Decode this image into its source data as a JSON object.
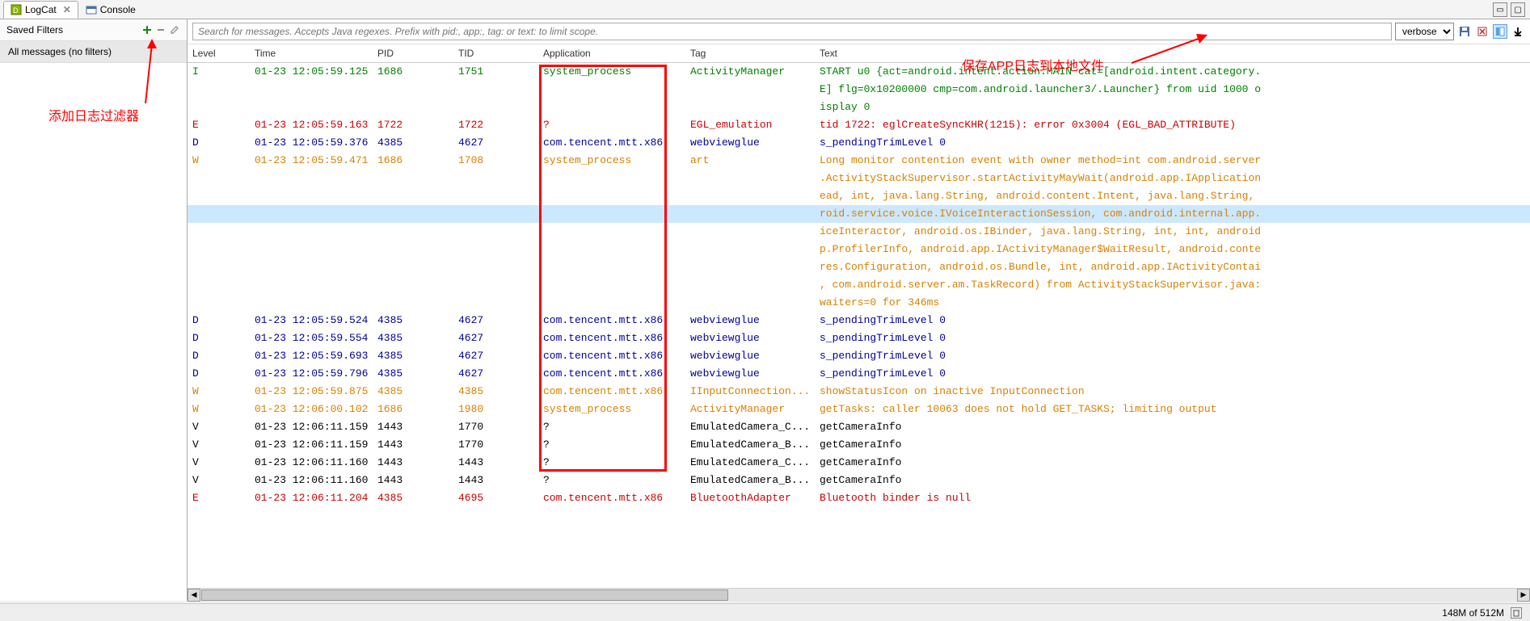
{
  "tabs": [
    {
      "label": "LogCat",
      "active": true
    },
    {
      "label": "Console",
      "active": false
    }
  ],
  "sidebar": {
    "title": "Saved Filters",
    "filter_item": "All messages (no filters)"
  },
  "annotations": {
    "add_filter": "添加日志过滤器",
    "save_log": "保存APP日志到本地文件"
  },
  "search": {
    "placeholder": "Search for messages. Accepts Java regexes. Prefix with pid:, app:, tag: or text: to limit scope."
  },
  "level_filter": {
    "value": "verbose"
  },
  "columns": {
    "level": "Level",
    "time": "Time",
    "pid": "PID",
    "tid": "TID",
    "app": "Application",
    "tag": "Tag",
    "text": "Text"
  },
  "logs": [
    {
      "lvl": "I",
      "time": "01-23 12:05:59.125",
      "pid": "1686",
      "tid": "1751",
      "app": "system_process",
      "tag": "ActivityManager",
      "text": "START u0 {act=android.intent.action.MAIN cat=[android.intent.category."
    },
    {
      "lvl": "",
      "time": "",
      "pid": "",
      "tid": "",
      "app": "",
      "tag": "",
      "text": "E] flg=0x10200000 cmp=com.android.launcher3/.Launcher} from uid 1000 o",
      "cls": "I"
    },
    {
      "lvl": "",
      "time": "",
      "pid": "",
      "tid": "",
      "app": "",
      "tag": "",
      "text": "isplay 0",
      "cls": "I"
    },
    {
      "lvl": "E",
      "time": "01-23 12:05:59.163",
      "pid": "1722",
      "tid": "1722",
      "app": "?",
      "tag": "EGL_emulation",
      "text": "tid 1722: eglCreateSyncKHR(1215): error 0x3004 (EGL_BAD_ATTRIBUTE)"
    },
    {
      "lvl": "D",
      "time": "01-23 12:05:59.376",
      "pid": "4385",
      "tid": "4627",
      "app": "com.tencent.mtt.x86",
      "tag": "webviewglue",
      "text": "s_pendingTrimLevel 0"
    },
    {
      "lvl": "W",
      "time": "01-23 12:05:59.471",
      "pid": "1686",
      "tid": "1708",
      "app": "system_process",
      "tag": "art",
      "text": "Long monitor contention event with owner method=int com.android.server"
    },
    {
      "lvl": "",
      "time": "",
      "pid": "",
      "tid": "",
      "app": "",
      "tag": "",
      "text": ".ActivityStackSupervisor.startActivityMayWait(android.app.IApplication",
      "cls": "W"
    },
    {
      "lvl": "",
      "time": "",
      "pid": "",
      "tid": "",
      "app": "",
      "tag": "",
      "text": "ead, int, java.lang.String, android.content.Intent, java.lang.String,",
      "cls": "W"
    },
    {
      "lvl": "",
      "time": "",
      "pid": "",
      "tid": "",
      "app": "",
      "tag": "",
      "text": "roid.service.voice.IVoiceInteractionSession, com.android.internal.app.",
      "cls": "W",
      "hl": true
    },
    {
      "lvl": "",
      "time": "",
      "pid": "",
      "tid": "",
      "app": "",
      "tag": "",
      "text": "iceInteractor, android.os.IBinder, java.lang.String, int, int, android",
      "cls": "W"
    },
    {
      "lvl": "",
      "time": "",
      "pid": "",
      "tid": "",
      "app": "",
      "tag": "",
      "text": "p.ProfilerInfo, android.app.IActivityManager$WaitResult, android.conte",
      "cls": "W"
    },
    {
      "lvl": "",
      "time": "",
      "pid": "",
      "tid": "",
      "app": "",
      "tag": "",
      "text": "res.Configuration, android.os.Bundle, int, android.app.IActivityContai",
      "cls": "W"
    },
    {
      "lvl": "",
      "time": "",
      "pid": "",
      "tid": "",
      "app": "",
      "tag": "",
      "text": ", com.android.server.am.TaskRecord) from ActivityStackSupervisor.java:",
      "cls": "W"
    },
    {
      "lvl": "",
      "time": "",
      "pid": "",
      "tid": "",
      "app": "",
      "tag": "",
      "text": " waiters=0 for 346ms",
      "cls": "W"
    },
    {
      "lvl": "D",
      "time": "01-23 12:05:59.524",
      "pid": "4385",
      "tid": "4627",
      "app": "com.tencent.mtt.x86",
      "tag": "webviewglue",
      "text": "s_pendingTrimLevel 0"
    },
    {
      "lvl": "D",
      "time": "01-23 12:05:59.554",
      "pid": "4385",
      "tid": "4627",
      "app": "com.tencent.mtt.x86",
      "tag": "webviewglue",
      "text": "s_pendingTrimLevel 0"
    },
    {
      "lvl": "D",
      "time": "01-23 12:05:59.693",
      "pid": "4385",
      "tid": "4627",
      "app": "com.tencent.mtt.x86",
      "tag": "webviewglue",
      "text": "s_pendingTrimLevel 0"
    },
    {
      "lvl": "D",
      "time": "01-23 12:05:59.796",
      "pid": "4385",
      "tid": "4627",
      "app": "com.tencent.mtt.x86",
      "tag": "webviewglue",
      "text": "s_pendingTrimLevel 0"
    },
    {
      "lvl": "W",
      "time": "01-23 12:05:59.875",
      "pid": "4385",
      "tid": "4385",
      "app": "com.tencent.mtt.x86",
      "tag": "IInputConnection...",
      "text": "showStatusIcon on inactive InputConnection"
    },
    {
      "lvl": "W",
      "time": "01-23 12:06:00.102",
      "pid": "1686",
      "tid": "1980",
      "app": "system_process",
      "tag": "ActivityManager",
      "text": "getTasks: caller 10063 does not hold GET_TASKS; limiting output"
    },
    {
      "lvl": "V",
      "time": "01-23 12:06:11.159",
      "pid": "1443",
      "tid": "1770",
      "app": "?",
      "tag": "EmulatedCamera_C...",
      "text": "getCameraInfo"
    },
    {
      "lvl": "V",
      "time": "01-23 12:06:11.159",
      "pid": "1443",
      "tid": "1770",
      "app": "?",
      "tag": "EmulatedCamera_B...",
      "text": "getCameraInfo"
    },
    {
      "lvl": "V",
      "time": "01-23 12:06:11.160",
      "pid": "1443",
      "tid": "1443",
      "app": "?",
      "tag": "EmulatedCamera_C...",
      "text": "getCameraInfo"
    },
    {
      "lvl": "V",
      "time": "01-23 12:06:11.160",
      "pid": "1443",
      "tid": "1443",
      "app": "?",
      "tag": "EmulatedCamera_B...",
      "text": "getCameraInfo"
    },
    {
      "lvl": "E",
      "time": "01-23 12:06:11.204",
      "pid": "4385",
      "tid": "4695",
      "app": "com.tencent.mtt.x86",
      "tag": "BluetoothAdapter",
      "text": "Bluetooth binder is null"
    }
  ],
  "status": {
    "heap": "148M of 512M"
  }
}
